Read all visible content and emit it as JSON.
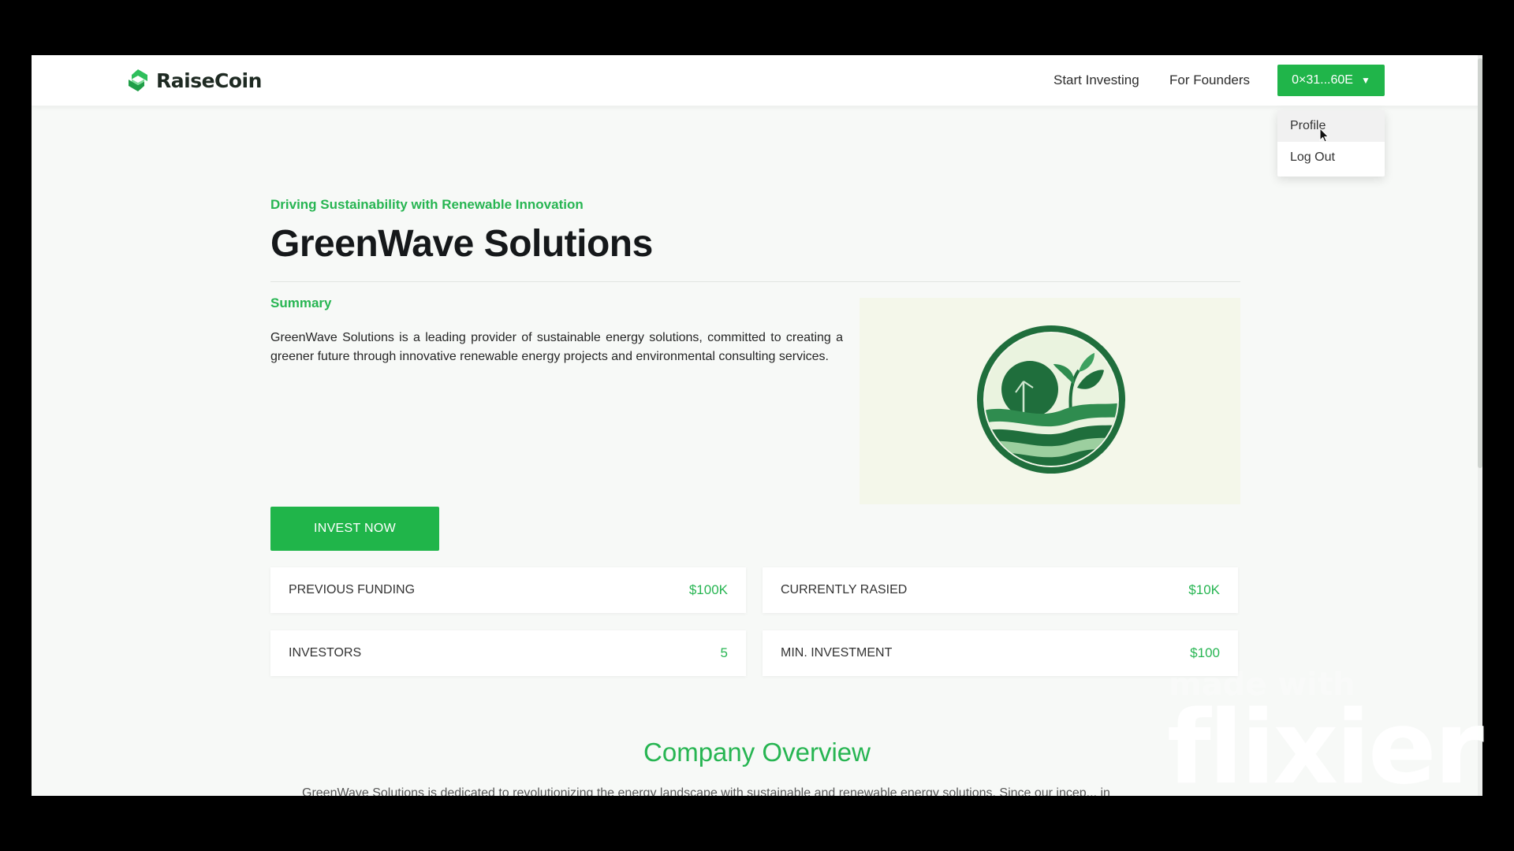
{
  "navbar": {
    "brand_name": "RaiseCoin",
    "links": [
      "Start Investing",
      "For Founders"
    ],
    "wallet_label": "0×31...60E",
    "dropdown": [
      "Profile",
      "Log Out"
    ]
  },
  "company": {
    "tagline": "Driving Sustainability with Renewable Innovation",
    "name": "GreenWave Solutions",
    "summary_label": "Summary",
    "summary": "GreenWave Solutions is a leading provider of sustainable energy solutions, committed to creating a greener future through innovative renewable energy projects and environmental consulting services.",
    "logo_icon": "greenwave-logo-icon"
  },
  "invest_button": "INVEST NOW",
  "stats": [
    {
      "label": "PREVIOUS FUNDING",
      "value": "$100K"
    },
    {
      "label": "CURRENTLY RASIED",
      "value": "$10K"
    },
    {
      "label": "INVESTORS",
      "value": "5"
    },
    {
      "label": "MIN. INVESTMENT",
      "value": "$100"
    }
  ],
  "overview": {
    "title": "Company Overview",
    "text": "GreenWave Solutions is dedicated to revolutionizing the energy landscape with sustainable and renewable energy solutions. Since our incep... in"
  },
  "watermark": {
    "line1": "made with",
    "line2": "flixier"
  },
  "colors": {
    "accent": "#20b54a",
    "accent_text": "#27b552"
  }
}
